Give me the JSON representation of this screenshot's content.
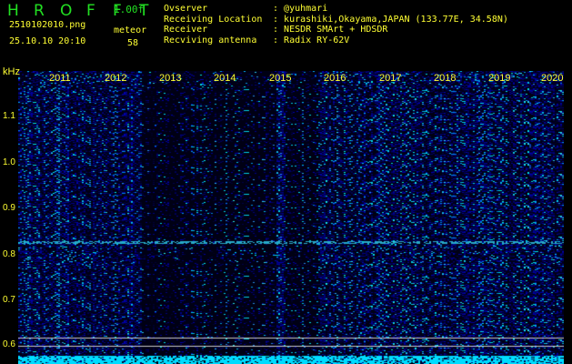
{
  "header": {
    "title_letters": [
      "H",
      "R",
      "O",
      "F",
      "F",
      "T"
    ],
    "version": "1.00f",
    "filename": "2510102010.png",
    "datetime": "25.10.10 20:10",
    "meteor_label": "meteor",
    "meteor_count": "58"
  },
  "info": [
    {
      "label": "Ovserver",
      "value": "@yuhmari"
    },
    {
      "label": "Receiving Location",
      "value": "kurashiki,Okayama,JAPAN (133.77E, 34.58N)"
    },
    {
      "label": "Receiver",
      "value": "NESDR SMArt + HDSDR"
    },
    {
      "label": "Recviving antenna",
      "value": "Radix RY-62V"
    }
  ],
  "axis": {
    "unit": "kHz",
    "ticks": [
      "1.1",
      "1.0",
      "0.9",
      "0.8",
      "0.7",
      "0.6"
    ],
    "years": [
      "2011",
      "2012",
      "2013",
      "2014",
      "2015",
      "2016",
      "2017",
      "2018",
      "2019",
      "2020"
    ]
  },
  "colors": {
    "background": "#000000",
    "text": "#ffff33",
    "title": "#22e022",
    "signal": "#2a2ad0"
  }
}
